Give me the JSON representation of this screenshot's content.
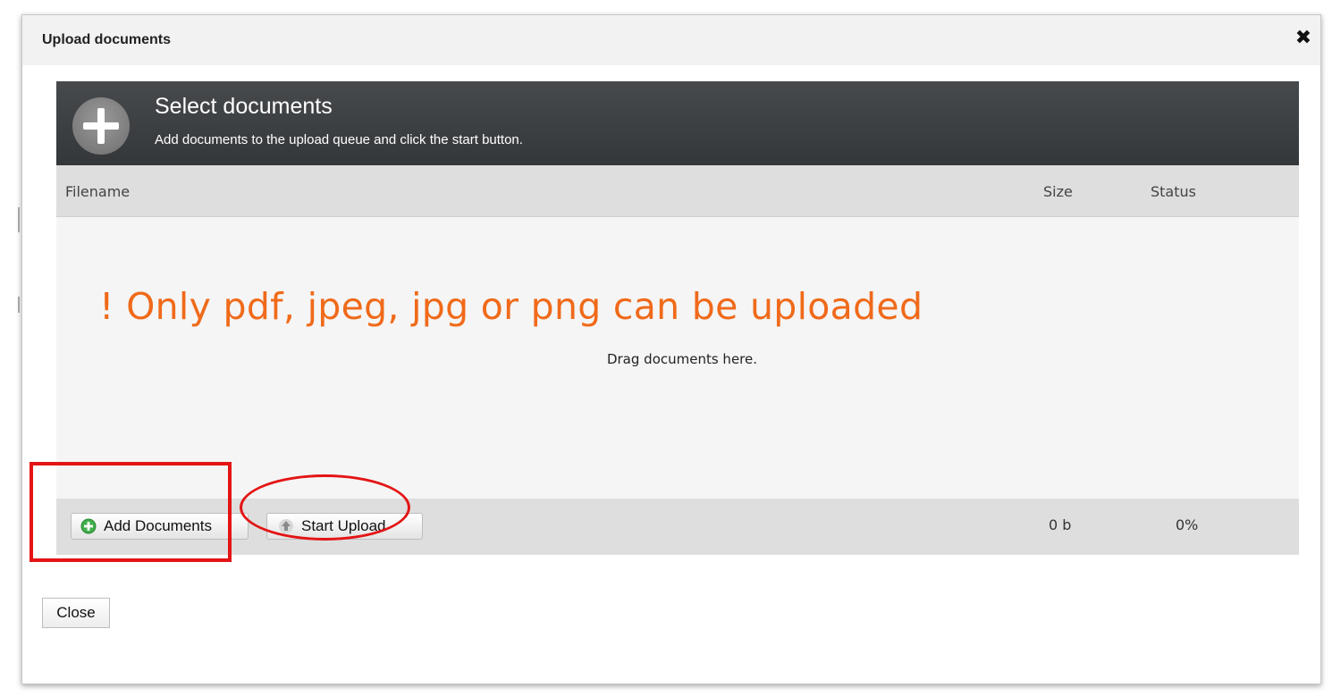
{
  "dialog": {
    "title": "Upload documents",
    "close_icon": "close-x-icon"
  },
  "uploader": {
    "header": {
      "icon": "plus-circle-icon",
      "title": "Select documents",
      "subtitle": "Add documents to the upload queue and click the start button."
    },
    "columns": {
      "filename": "Filename",
      "size": "Size",
      "status": "Status"
    },
    "drop_area": {
      "note": "! Only pdf, jpeg, jpg or png can be uploaded",
      "drag_text": "Drag documents here."
    },
    "footer": {
      "add_button": "Add Documents",
      "add_icon": "add-circle-icon",
      "start_button": "Start Upload",
      "start_icon": "arrow-up-icon",
      "total_size": "0 b",
      "total_percent": "0%"
    }
  },
  "close_button": "Close",
  "colors": {
    "header_dark": "#3d4043",
    "note_orange": "#f06a1a",
    "annotation_red": "#e41414",
    "add_icon_green": "#3fae4a"
  }
}
